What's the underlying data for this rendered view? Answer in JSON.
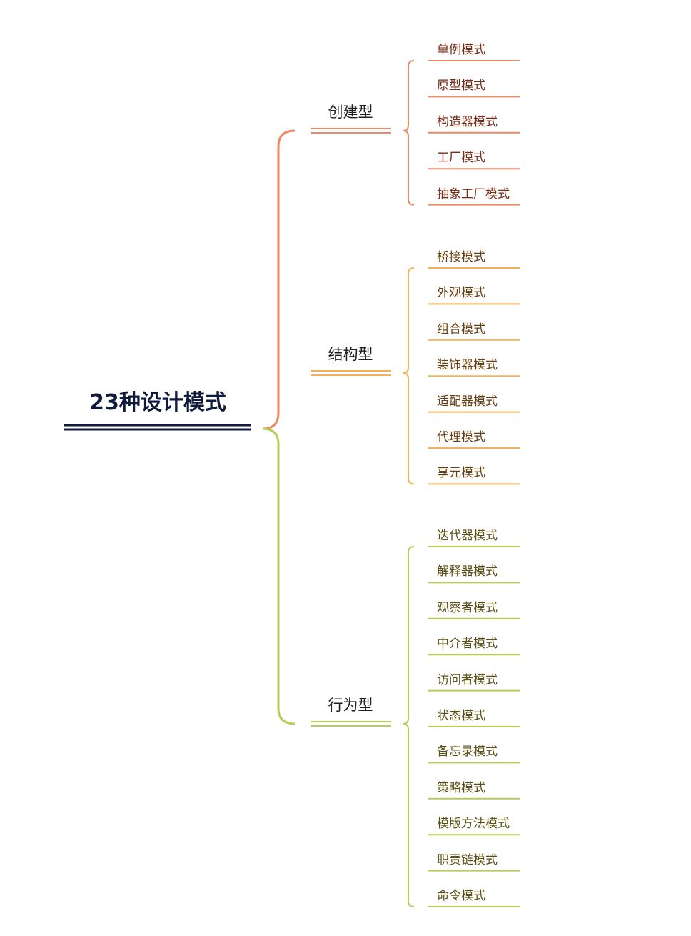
{
  "root": {
    "label": "23种设计模式",
    "color": "#101a3a"
  },
  "categories": [
    {
      "label": "创建型",
      "color": "#ea8a66",
      "items": [
        "单例模式",
        "原型模式",
        "构造器模式",
        "工厂模式",
        "抽象工厂模式"
      ]
    },
    {
      "label": "结构型",
      "color": "#f1b25a",
      "items": [
        "桥接模式",
        "外观模式",
        "组合模式",
        "装饰器模式",
        "适配器模式",
        "代理模式",
        "享元模式"
      ]
    },
    {
      "label": "行为型",
      "color": "#b9cc58",
      "items": [
        "迭代器模式",
        "解释器模式",
        "观察者模式",
        "中介者模式",
        "访问者模式",
        "状态模式",
        "备忘录模式",
        "策略模式",
        "模版方法模式",
        "职责链模式",
        "命令模式"
      ]
    }
  ]
}
